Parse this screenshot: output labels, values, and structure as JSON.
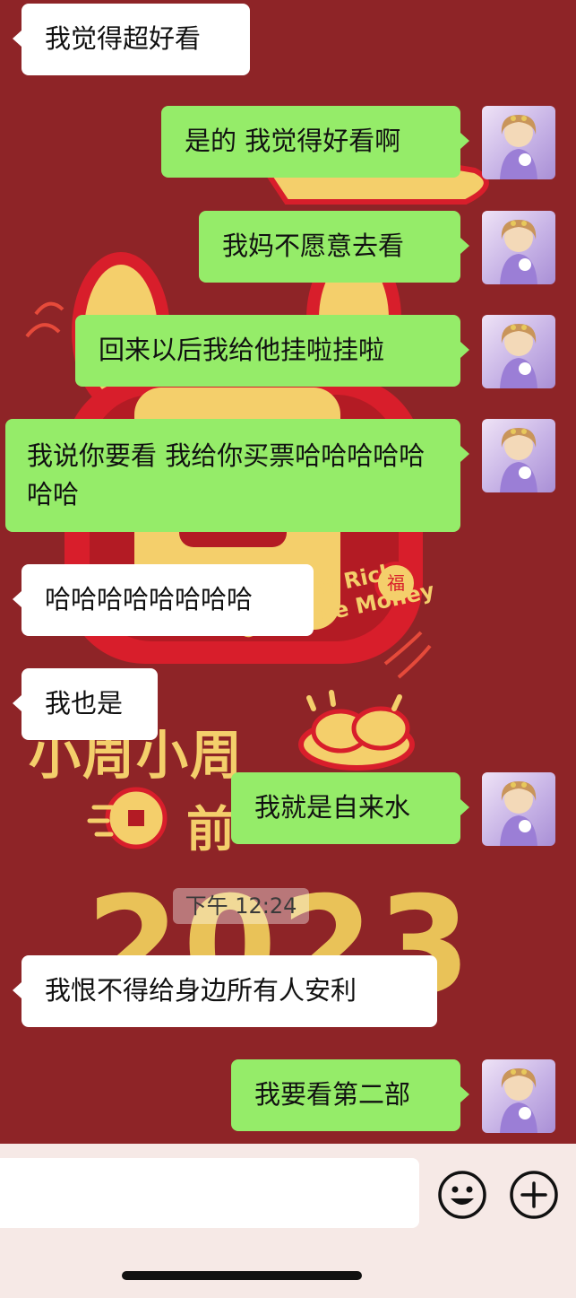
{
  "wallpaper": {
    "line_xiaozhou": "小周小周",
    "line_qian": "前",
    "year": "2023",
    "slogan_1": "Get Rich",
    "slogan_2": "Get More Money",
    "seal": "福"
  },
  "messages": [
    {
      "side": "left",
      "text": "我觉得超好看"
    },
    {
      "side": "right",
      "text": "是的 我觉得好看啊"
    },
    {
      "side": "right",
      "text": "我妈不愿意去看"
    },
    {
      "side": "right",
      "text": "回来以后我给他挂啦挂啦"
    },
    {
      "side": "right",
      "text": "我说你要看 我给你买票哈哈哈哈哈哈哈"
    },
    {
      "side": "left",
      "text": "哈哈哈哈哈哈哈哈"
    },
    {
      "side": "left",
      "text": "我也是"
    },
    {
      "side": "right",
      "text": "我就是自来水"
    },
    {
      "side": "left",
      "text": "我恨不得给身边所有人安利"
    },
    {
      "side": "right",
      "text": "我要看第二部"
    }
  ],
  "timestamp": "下午 12:24",
  "input_bar": {
    "input_value": "",
    "emoji_icon": "emoji-smile-icon",
    "more_icon": "plus-circle-icon"
  },
  "colors": {
    "background": "#8e2427",
    "bubble_self": "#95ec69",
    "bubble_other": "#ffffff",
    "wallpaper_gold": "#f4cf6b"
  }
}
